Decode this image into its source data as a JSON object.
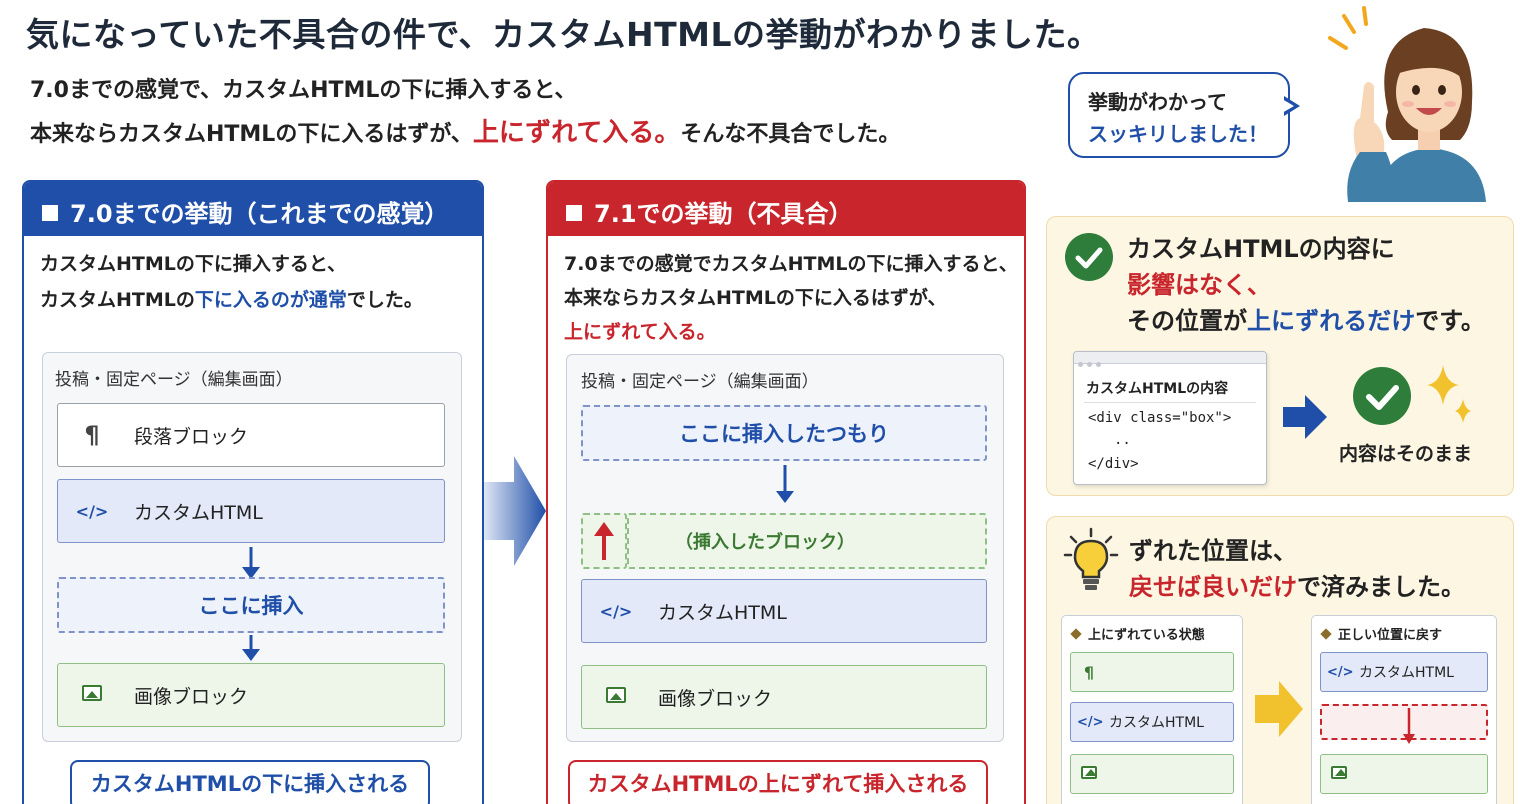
{
  "header": {
    "title": "気になっていた不具合の件で、カスタムHTMLの挙動がわかりました。",
    "intro_line1": "7.0までの感覚で、カスタムHTMLの下に挿入すると、",
    "intro_line2_a": "本来ならカスタムHTMLの下に入るはずが、",
    "intro_line2_red": "上にずれて入る。",
    "intro_line2_b": "そんな不具合でした。"
  },
  "bubble": {
    "line1": "挙動がわかって",
    "line2": "スッキリしました！"
  },
  "left_panel": {
    "heading": "7.0までの挙動（これまでの感覚）",
    "desc_line1": "カスタムHTMLの下に挿入すると、",
    "desc_line2_a": "カスタムHTMLの",
    "desc_line2_blue": "下に入るのが通常",
    "desc_line2_b": "でした。",
    "editor_title": "投稿・固定ページ（編集画面）",
    "block_para": "段落ブロック",
    "block_html": "カスタムHTML",
    "insert_here": "ここに挿入",
    "block_image": "画像ブロック",
    "result": "カスタムHTMLの下に挿入される"
  },
  "mid_panel": {
    "heading": "7.1での挙動（不具合）",
    "desc_line1": "7.0までの感覚でカスタムHTMLの下に挿入すると、",
    "desc_line2": "本来ならカスタムHTMLの下に入るはずが、",
    "desc_line3_red": "上にずれて入る。",
    "editor_title": "投稿・固定ページ（編集画面）",
    "intended": "ここに挿入したつもり",
    "inserted": "（挿入したブロック）",
    "block_html": "カスタムHTML",
    "block_image": "画像ブロック",
    "result": "カスタムHTMLの上にずれて挿入される"
  },
  "card1": {
    "line1": "カスタムHTMLの内容に",
    "line2_red": "影響はなく、",
    "line3_a": "その位置が",
    "line3_blue": "上にずれるだけ",
    "line3_b": "です。",
    "code_title": "カスタムHTMLの内容",
    "code_line1": "<div class=\"box\">",
    "code_line2": "..",
    "code_line3": "</div>",
    "result_label": "内容はそのまま"
  },
  "card2": {
    "line1": "ずれた位置は、",
    "line2_red": "戻せば良いだけ",
    "line2_b": "で済みました。",
    "mini_left_title": "上にずれている状態",
    "mini_left_html": "カスタムHTML",
    "mini_right_title": "正しい位置に戻す",
    "mini_right_html": "カスタムHTML"
  },
  "icons": {
    "paragraph": "¶",
    "html": "</>"
  },
  "colors": {
    "blue": "#1f4fa8",
    "red": "#c8262c",
    "green": "#2e7d3a",
    "card_bg": "#fdf6e2",
    "yellow_arrow": "#f2c12e"
  }
}
